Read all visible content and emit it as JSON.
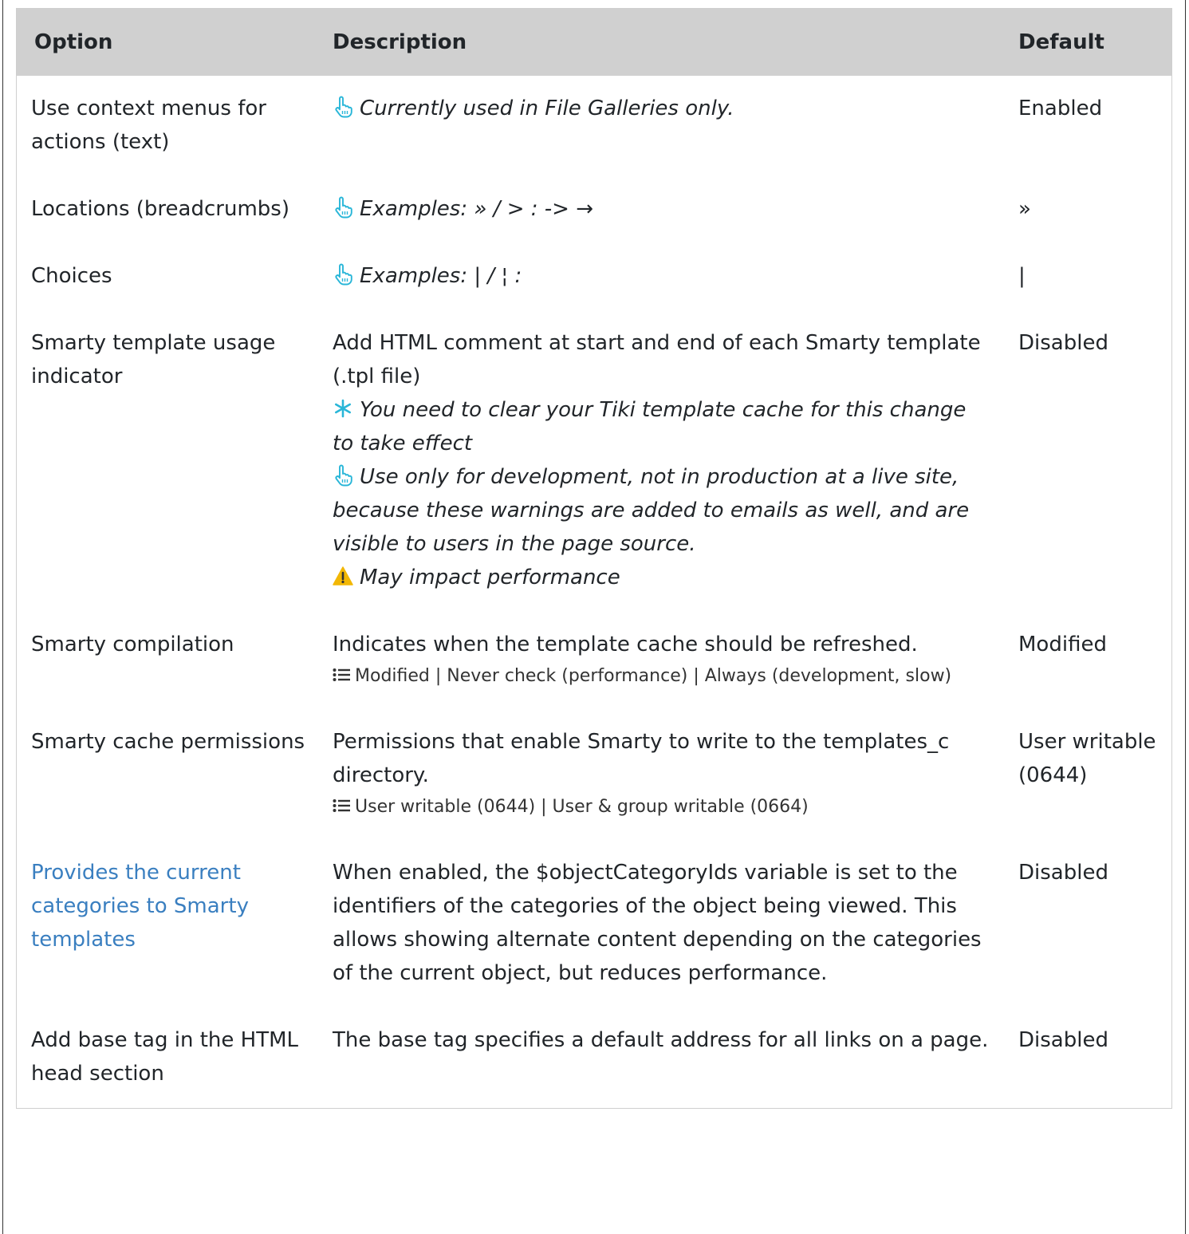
{
  "header": {
    "option": "Option",
    "description": "Description",
    "default": "Default"
  },
  "icons": {
    "hint": "pointing-hand-icon",
    "restart": "asterisk-icon",
    "warning": "warning-icon",
    "options": "list-icon",
    "hint_color": "#29b6d8",
    "warning_color": "#f2b705"
  },
  "rows": [
    {
      "option": "Use context menus for actions (text)",
      "hint": "Currently used in File Galleries only.",
      "default": "Enabled"
    },
    {
      "option": "Locations (breadcrumbs)",
      "hint": "Examples: » / > : -> →",
      "default": "»"
    },
    {
      "option": "Choices",
      "hint": "Examples: | / ¦ :",
      "default": "|"
    },
    {
      "option": "Smarty template usage indicator",
      "description": "Add HTML comment at start and end of each Smarty template (.tpl file)",
      "restart_note": "You need to clear your Tiki template cache for this change to take effect",
      "hint": "Use only for development, not in production at a live site, because these warnings are added to emails as well, and are visible to users in the page source.",
      "warning": "May impact performance",
      "default": "Disabled"
    },
    {
      "option": "Smarty compilation",
      "description": "Indicates when the template cache should be refreshed.",
      "options": "Modified | Never check (performance) | Always (development, slow)",
      "default": "Modified"
    },
    {
      "option": "Smarty cache permissions",
      "description": "Permissions that enable Smarty to write to the templates_c directory.",
      "options": "User writable (0644) | User & group writable (0664)",
      "default": "User writable (0644)"
    },
    {
      "option": "Provides the current categories to Smarty templates",
      "description": "When enabled, the $objectCategoryIds variable is set to the identifiers of the categories of the object being viewed. This allows showing alternate content depending on the categories of the current object, but reduces performance.",
      "default": "Disabled"
    },
    {
      "option": "Add base tag in the HTML head section",
      "description": "The base tag specifies a default address for all links on a page.",
      "default": "Disabled"
    }
  ]
}
